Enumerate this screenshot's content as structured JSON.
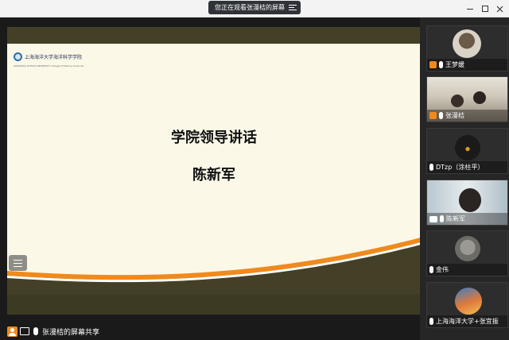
{
  "window": {
    "share_notice": "您正在观看张漫桔的屏幕"
  },
  "slide": {
    "logo_text": "上海海洋大学海洋科学学院",
    "logo_subtitle": "SHANGHAI OCEAN UNIVERSITY College Of Marine Sciences",
    "title": "学院领导讲话",
    "speaker": "陈新军"
  },
  "sharer": {
    "label": "张漫桔的屏幕共享"
  },
  "participants": [
    {
      "name": "王梦媛"
    },
    {
      "name": "张漫桔"
    },
    {
      "name": "DTzp（涂柱平）"
    },
    {
      "name": "陈新军"
    },
    {
      "name": "金伟"
    },
    {
      "name": "上海海洋大学+张宜振"
    }
  ],
  "colors": {
    "accent_orange": "#f08a1c",
    "slide_bg": "#fbf8e8",
    "slide_band": "#444027"
  }
}
